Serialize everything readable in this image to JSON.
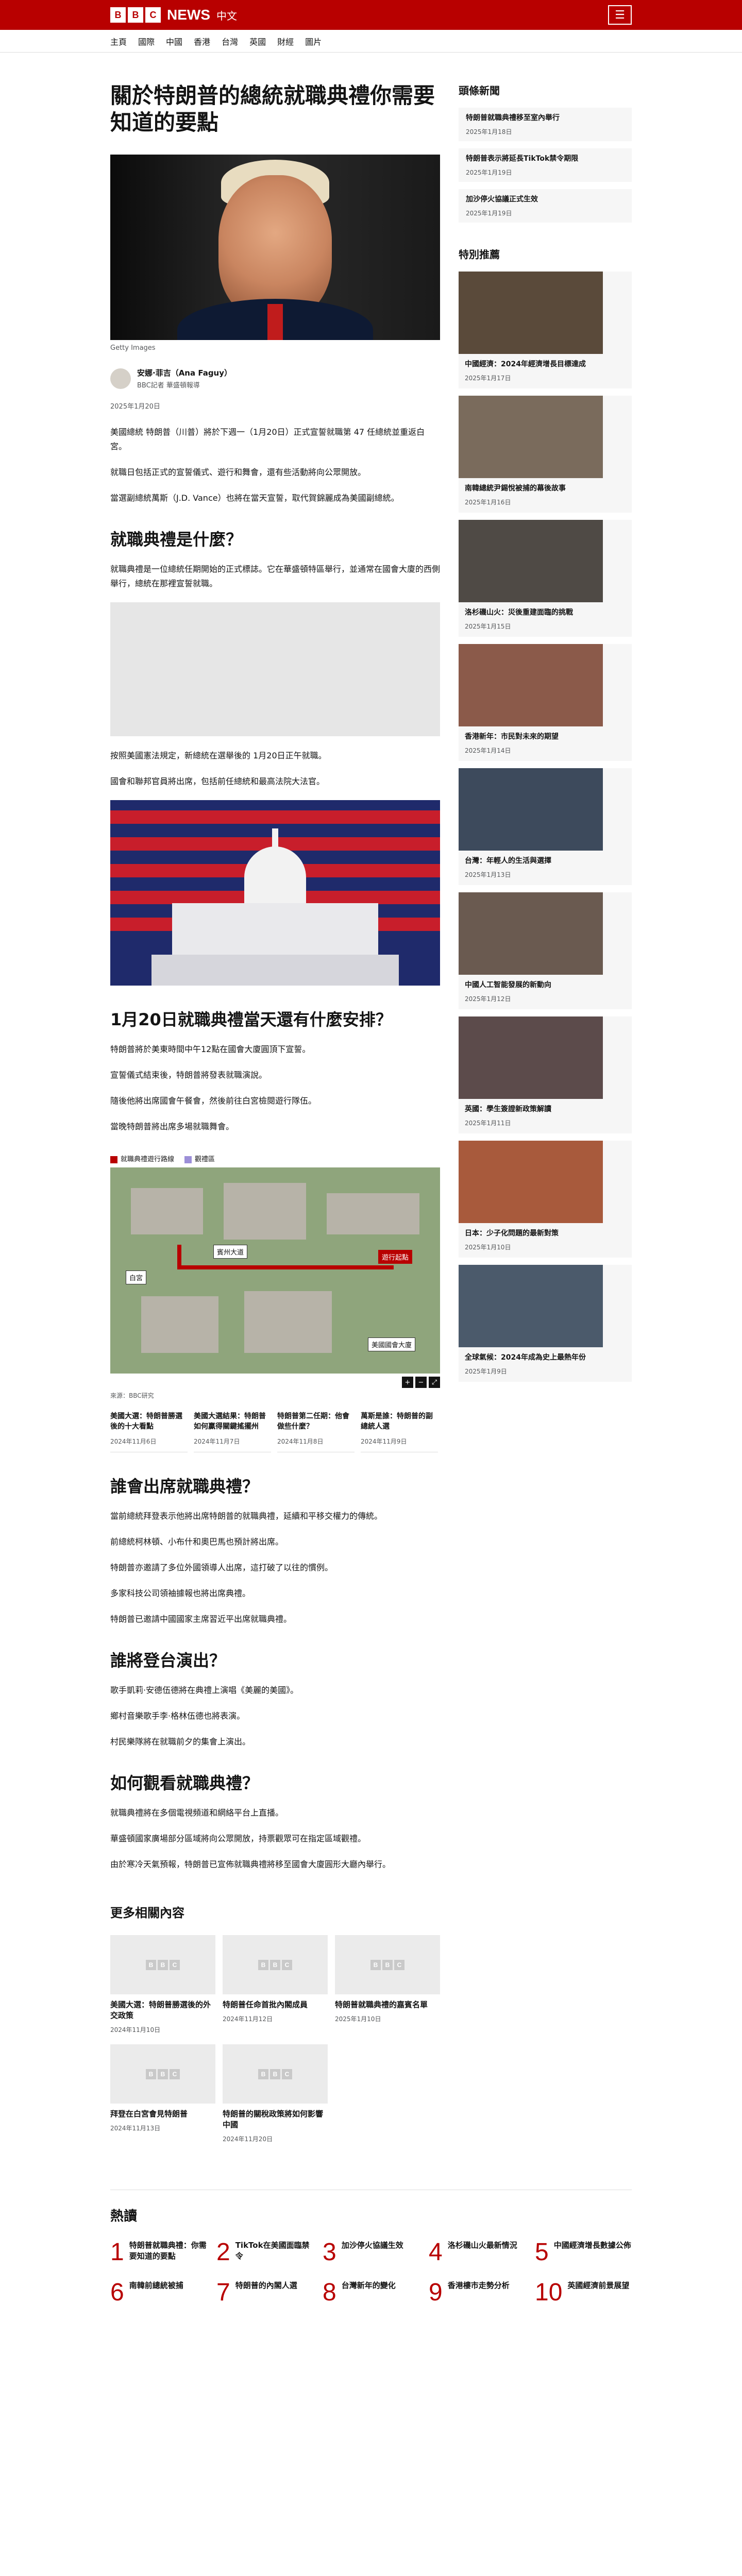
{
  "header": {
    "logo_letters": [
      "B",
      "B",
      "C"
    ],
    "news": "NEWS",
    "lang": "中文",
    "menu_icon": "menu-icon"
  },
  "nav": [
    "主頁",
    "國際",
    "中國",
    "香港",
    "台灣",
    "英國",
    "財經",
    "圖片"
  ],
  "article": {
    "headline": "關於特朗普的總統就職典禮你需要知道的要點",
    "hero_caption": "Getty Images",
    "author": "安娜·菲吉（Ana Faguy）",
    "author_role": "BBC記者 華盛頓報導",
    "date": "2025年1月20日",
    "intro": [
      "美國總統 特朗普（川普）將於下週一（1月20日）正式宣誓就職第 47 任總統並重返白宮。",
      "就職日包括正式的宣誓儀式、遊行和舞會，還有些活動將向公眾開放。",
      "當選副總統萬斯（J.D. Vance）也將在當天宣誓，取代賀錦麗成為美國副總統。"
    ],
    "h_what": "就職典禮是什麼？",
    "what_p": [
      "就職典禮是一位總統任期開始的正式標誌。它在華盛頓特區舉行，並通常在國會大廈的西側舉行，總統在那裡宣誓就職。",
      "按照美國憲法規定，新總統在選舉後的 1月20日正午就職。",
      "國會和聯邦官員將出席，包括前任總統和最高法院大法官。"
    ],
    "h_when": "1月20日就職典禮當天還有什麼安排？",
    "when_p": [
      "特朗普將於美東時間中午12點在國會大廈圓頂下宣誓。",
      "宣誓儀式結束後，特朗普將發表就職演說。",
      "隨後他將出席國會午餐會，然後前往白宮檢閱遊行隊伍。",
      "當晚特朗普將出席多場就職舞會。"
    ],
    "map": {
      "legend_route": "就職典禮遊行路線",
      "legend_zone": "觀禮區",
      "labels": {
        "whitehouse": "白宮",
        "capitol": "美國國會大廈",
        "penn": "賓州大道",
        "parade": "遊行起點"
      },
      "credit": "來源：BBC研究"
    },
    "related": [
      {
        "title": "美國大選：特朗普勝選後的十大看點",
        "date": "2024年11月6日"
      },
      {
        "title": "美國大選結果：特朗普如何贏得關鍵搖擺州",
        "date": "2024年11月7日"
      },
      {
        "title": "特朗普第二任期：他會做些什麼？",
        "date": "2024年11月8日"
      },
      {
        "title": "萬斯是誰：特朗普的副總統人選",
        "date": "2024年11月9日"
      }
    ],
    "h_who": "誰會出席就職典禮？",
    "who_p": [
      "當前總統拜登表示他將出席特朗普的就職典禮，延續和平移交權力的傳統。",
      "前總統柯林頓、小布什和奧巴馬也預計將出席。",
      "特朗普亦邀請了多位外國領導人出席，這打破了以往的慣例。",
      "多家科技公司領袖據報也將出席典禮。",
      "特朗普已邀請中國國家主席習近平出席就職典禮。"
    ],
    "h_perform": "誰將登台演出？",
    "perform_p": [
      "歌手凱莉·安德伍德將在典禮上演唱《美麗的美國》。",
      "鄉村音樂歌手李·格林伍德也將表演。",
      "村民樂隊將在就職前夕的集會上演出。"
    ],
    "h_watch": "如何觀看就職典禮？",
    "watch_p": [
      "就職典禮將在多個電視頻道和網絡平台上直播。",
      "華盛頓國家廣場部分區域將向公眾開放，持票觀眾可在指定區域觀禮。",
      "由於寒冷天氣預報，特朗普已宣佈就職典禮將移至國會大廈圓形大廳內舉行。"
    ]
  },
  "more": {
    "heading": "更多相關內容",
    "items": [
      {
        "title": "美國大選：特朗普勝選後的外交政策",
        "date": "2024年11月10日"
      },
      {
        "title": "特朗普任命首批內閣成員",
        "date": "2024年11月12日"
      },
      {
        "title": "特朗普就職典禮的嘉賓名單",
        "date": "2025年1月10日"
      },
      {
        "title": "拜登在白宮會見特朗普",
        "date": "2024年11月13日"
      },
      {
        "title": "特朗普的關稅政策將如何影響中國",
        "date": "2024年11月20日"
      }
    ]
  },
  "sidebar": {
    "top_heading": "頭條新聞",
    "top": [
      {
        "title": "特朗普就職典禮移至室內舉行",
        "date": "2025年1月18日"
      },
      {
        "title": "特朗普表示將延長TikTok禁令期限",
        "date": "2025年1月19日"
      },
      {
        "title": "加沙停火協議正式生效",
        "date": "2025年1月19日"
      }
    ],
    "feature_heading": "特別推薦",
    "features": [
      {
        "title": "中國經濟：2024年經濟增長目標達成",
        "date": "2025年1月17日",
        "color": "#5a4a3a"
      },
      {
        "title": "南韓總統尹錫悅被捕的幕後故事",
        "date": "2025年1月16日",
        "color": "#7a6b5c"
      },
      {
        "title": "洛杉磯山火：災後重建面臨的挑戰",
        "date": "2025年1月15日",
        "color": "#4f4a45"
      },
      {
        "title": "香港新年：市民對未來的期望",
        "date": "2025年1月14日",
        "color": "#8b5a4a"
      },
      {
        "title": "台灣：年輕人的生活與選擇",
        "date": "2025年1月13日",
        "color": "#3d4a5c"
      },
      {
        "title": "中國人工智能發展的新動向",
        "date": "2025年1月12日",
        "color": "#6a5a50"
      },
      {
        "title": "英國：學生簽證新政策解讀",
        "date": "2025年1月11日",
        "color": "#5c4b4b"
      },
      {
        "title": "日本：少子化問題的最新對策",
        "date": "2025年1月10日",
        "color": "#a85a3c"
      },
      {
        "title": "全球氣候：2024年成為史上最熱年份",
        "date": "2025年1月9日",
        "color": "#4b5a6b"
      }
    ]
  },
  "mostread": {
    "heading": "熱讀",
    "items": [
      {
        "num": "1",
        "title": "特朗普就職典禮：你需要知道的要點"
      },
      {
        "num": "2",
        "title": "TikTok在美國面臨禁令"
      },
      {
        "num": "3",
        "title": "加沙停火協議生效"
      },
      {
        "num": "4",
        "title": "洛杉磯山火最新情況"
      },
      {
        "num": "5",
        "title": "中國經濟增長數據公佈"
      },
      {
        "num": "6",
        "title": "南韓前總統被捕"
      },
      {
        "num": "7",
        "title": "特朗普的內閣人選"
      },
      {
        "num": "8",
        "title": "台灣新年的變化"
      },
      {
        "num": "9",
        "title": "香港樓市走勢分析"
      },
      {
        "num": "10",
        "title": "英國經濟前景展望"
      }
    ]
  }
}
